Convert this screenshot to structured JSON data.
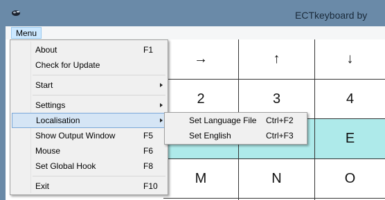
{
  "window": {
    "title": "ECTkeyboard by"
  },
  "menubar": {
    "menu_label": "Menu"
  },
  "dropdown": {
    "items": [
      {
        "label": "About",
        "shortcut": "F1"
      },
      {
        "label": "Check for Update",
        "shortcut": ""
      },
      {
        "label": "Start",
        "shortcut": ""
      },
      {
        "label": "Settings",
        "shortcut": ""
      },
      {
        "label": "Localisation",
        "shortcut": ""
      },
      {
        "label": "Show Output Window",
        "shortcut": "F5"
      },
      {
        "label": "Mouse",
        "shortcut": "F6"
      },
      {
        "label": "Set Global Hook",
        "shortcut": "F8"
      },
      {
        "label": "Exit",
        "shortcut": "F10"
      }
    ]
  },
  "submenu": {
    "items": [
      {
        "label": "Set Language File",
        "shortcut": "Ctrl+F2"
      },
      {
        "label": "Set English",
        "shortcut": "Ctrl+F3"
      }
    ]
  },
  "keys": {
    "row1": [
      "→",
      "↑",
      "↓"
    ],
    "row2": [
      "2",
      "3",
      "4"
    ],
    "row3": [
      "",
      "",
      "E"
    ],
    "row4": [
      "M",
      "N",
      "O"
    ]
  },
  "colors": {
    "title_bar": "#6a8aa8",
    "highlight_row": "#aeeaea",
    "menu_highlight": "#d5e5f5"
  }
}
